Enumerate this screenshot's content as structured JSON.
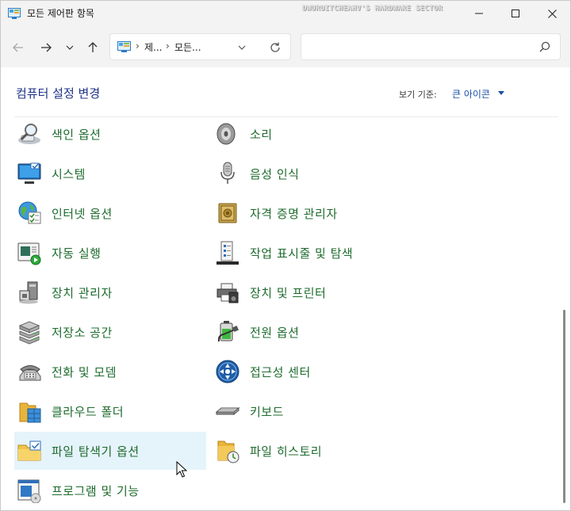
{
  "window": {
    "title": "모든 제어판 항목",
    "watermark": "DWURUITCHEAHV'S HARDWARE SECTOR"
  },
  "address": {
    "crumbs": [
      "제...",
      "모든..."
    ]
  },
  "search": {
    "placeholder": ""
  },
  "header": {
    "title": "컴퓨터 설정 변경",
    "view_by_label": "보기 기준:",
    "view_by_value": "큰 아이콘"
  },
  "items_left": [
    {
      "label": "색인 옵션",
      "icon": "indexing-options-icon"
    },
    {
      "label": "시스템",
      "icon": "system-icon"
    },
    {
      "label": "인터넷 옵션",
      "icon": "internet-options-icon"
    },
    {
      "label": "자동 실행",
      "icon": "autoplay-icon"
    },
    {
      "label": "장치 관리자",
      "icon": "device-manager-icon"
    },
    {
      "label": "저장소 공간",
      "icon": "storage-spaces-icon"
    },
    {
      "label": "전화 및 모뎀",
      "icon": "phone-modem-icon"
    },
    {
      "label": "클라우드 폴더",
      "icon": "cloud-folder-icon"
    },
    {
      "label": "파일 탐색기 옵션",
      "icon": "file-explorer-options-icon"
    },
    {
      "label": "프로그램 및 기능",
      "icon": "programs-features-icon"
    }
  ],
  "items_right": [
    {
      "label": "소리",
      "icon": "sound-icon"
    },
    {
      "label": "음성 인식",
      "icon": "speech-recognition-icon"
    },
    {
      "label": "자격 증명 관리자",
      "icon": "credential-manager-icon"
    },
    {
      "label": "작업 표시줄 및 탐색",
      "icon": "taskbar-navigation-icon"
    },
    {
      "label": "장치 및 프린터",
      "icon": "devices-printers-icon"
    },
    {
      "label": "전원 옵션",
      "icon": "power-options-icon"
    },
    {
      "label": "접근성 센터",
      "icon": "ease-of-access-icon"
    },
    {
      "label": "키보드",
      "icon": "keyboard-icon"
    },
    {
      "label": "파일 히스토리",
      "icon": "file-history-icon"
    }
  ],
  "colors": {
    "link_green": "#1e6b2e",
    "title_blue": "#1e3287",
    "accent_blue": "#1b4fa8",
    "hover_bg": "#e5f3fb"
  },
  "hovered_item": "파일 탐색기 옵션"
}
